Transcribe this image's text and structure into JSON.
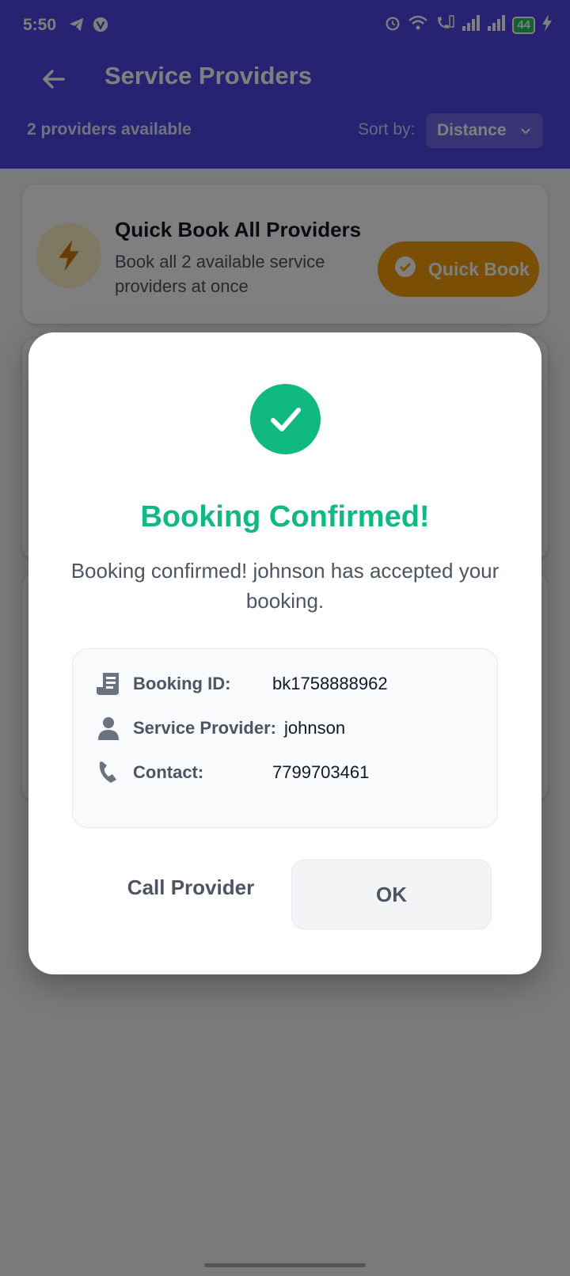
{
  "status_bar": {
    "time": "5:50",
    "battery": "44",
    "icons": [
      "telegram-icon",
      "app-icon",
      "alarm-icon",
      "wifi-icon",
      "wifi-calling-icon",
      "signal-icon",
      "signal-icon",
      "battery-icon",
      "charging-icon"
    ]
  },
  "header": {
    "title": "Service Providers",
    "subtitle": "2 providers available",
    "sort_label": "Sort by:",
    "sort_value": "Distance"
  },
  "quick_book": {
    "title": "Quick Book All Providers",
    "description": "Book all 2 available service providers at once",
    "button_label": "Quick Book"
  },
  "dialog": {
    "title": "Booking Confirmed!",
    "message": "Booking confirmed! johnson has accepted your booking.",
    "details": {
      "booking_id_label": "Booking ID:",
      "booking_id": "bk1758888962",
      "provider_label": "Service Provider:",
      "provider": "johnson",
      "contact_label": "Contact:",
      "contact": "7799703461"
    },
    "call_button": "Call Provider",
    "ok_button": "OK"
  },
  "colors": {
    "primary": "#4f46e5",
    "success": "#10b981",
    "amber": "#f59e0b"
  }
}
